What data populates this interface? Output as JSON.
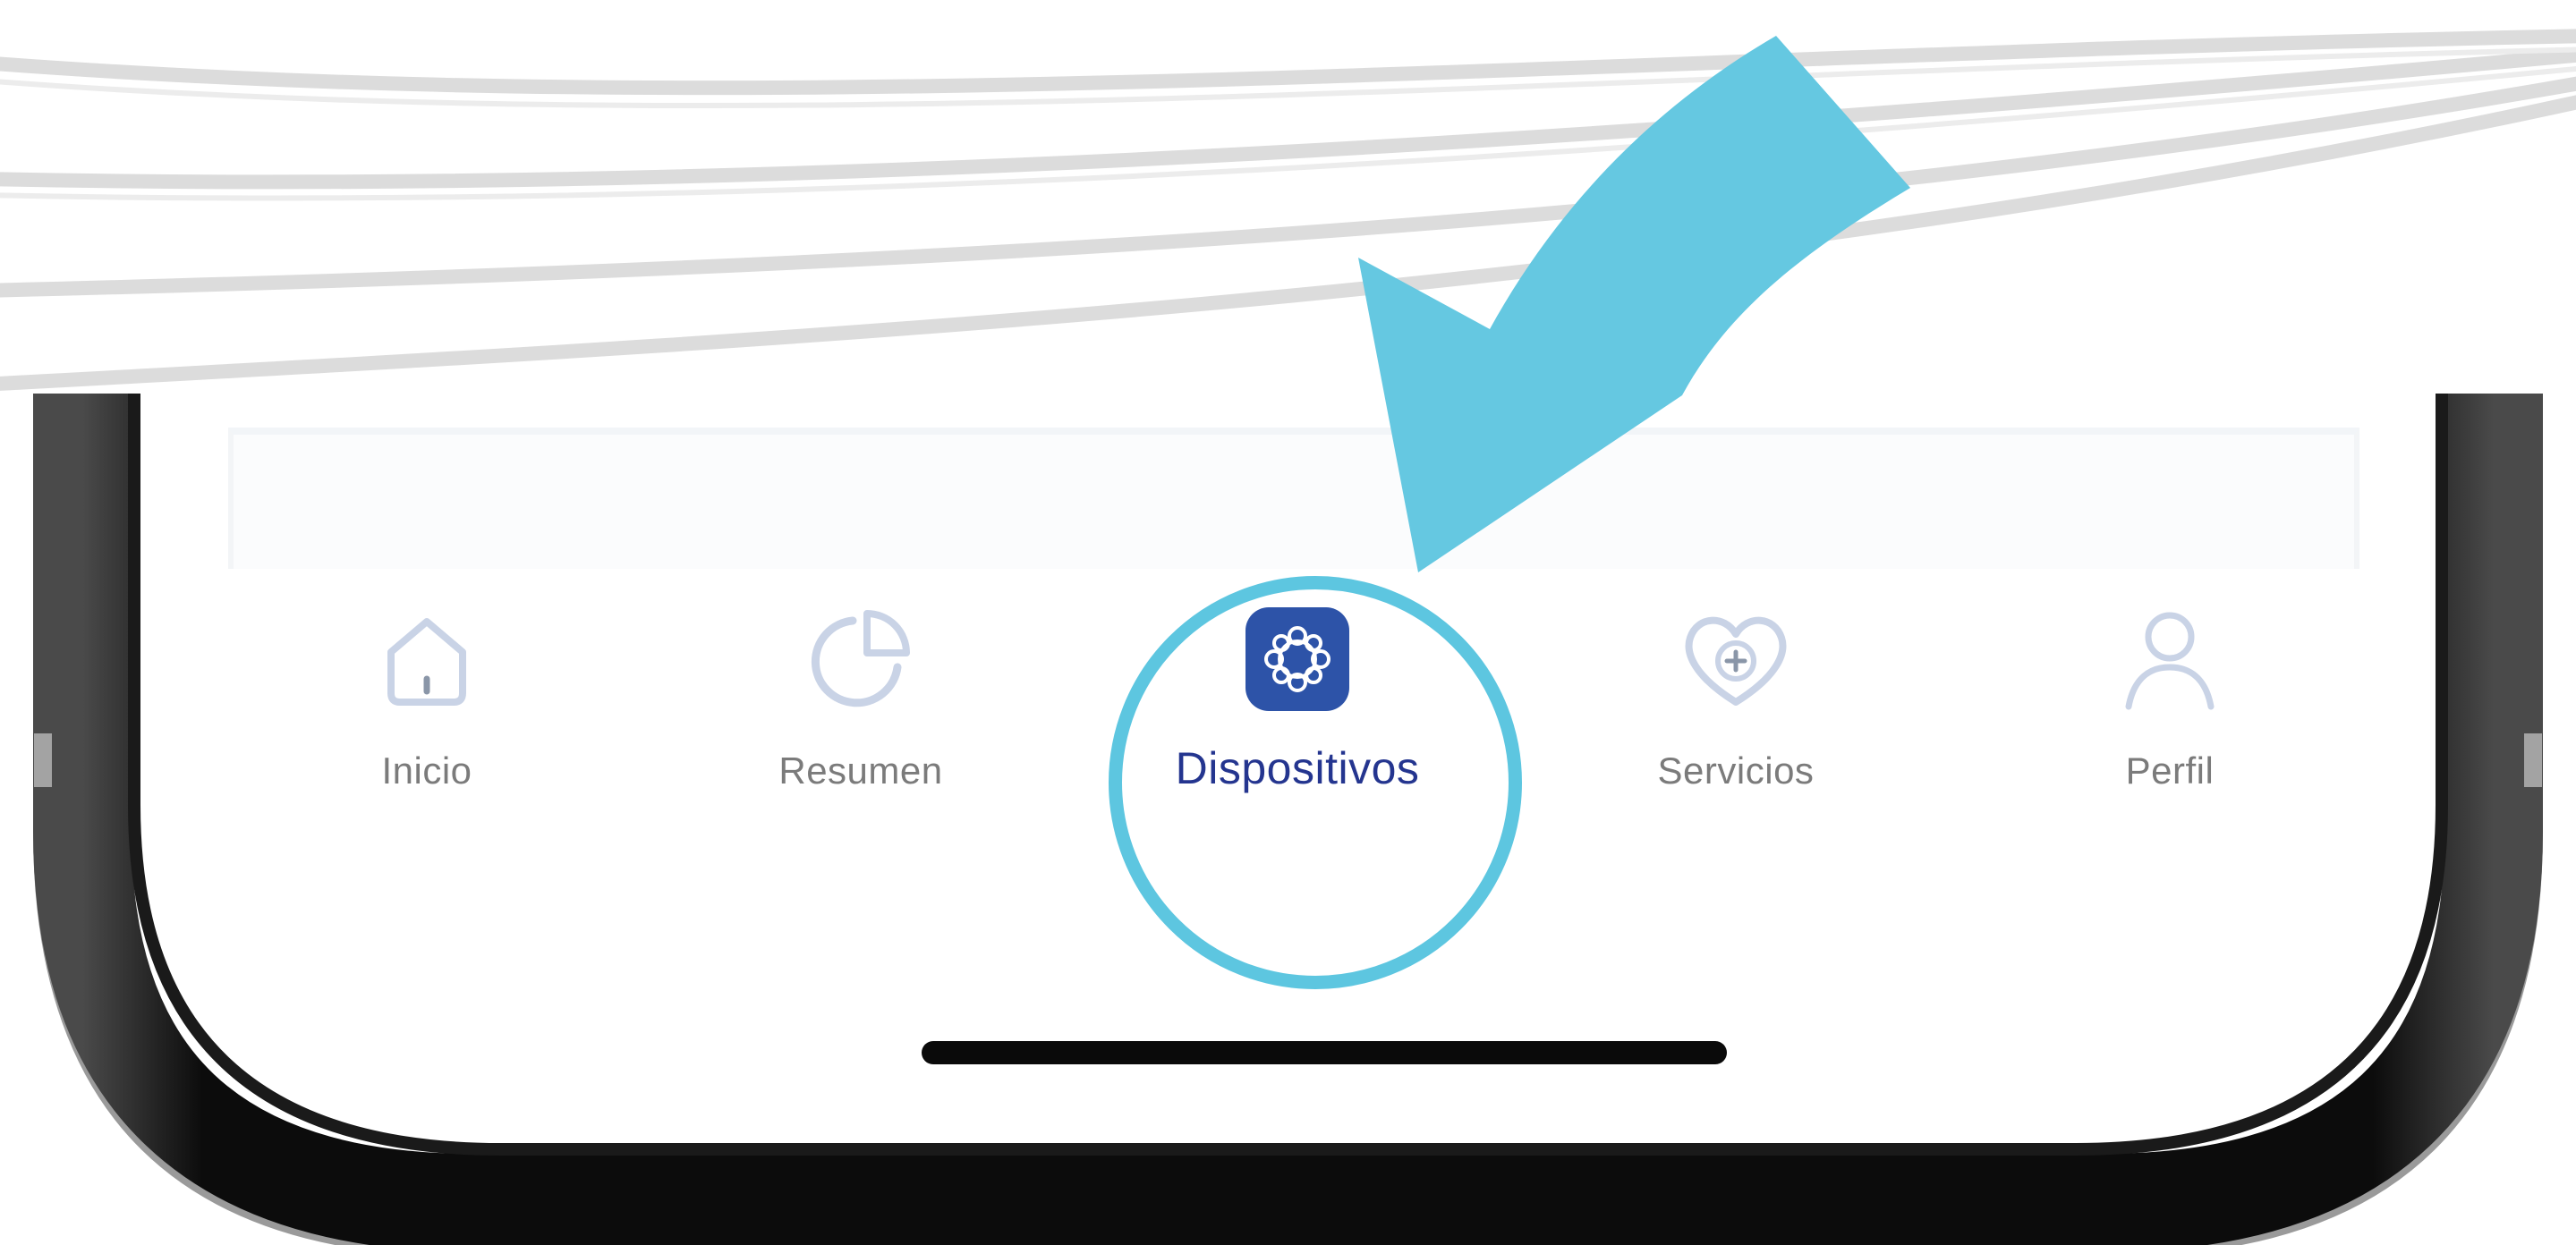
{
  "nav": {
    "tabs": [
      {
        "label": "Inicio",
        "icon": "home-icon",
        "active": false
      },
      {
        "label": "Resumen",
        "icon": "pie-chart-icon",
        "active": false
      },
      {
        "label": "Dispositivos",
        "icon": "devices-icon",
        "active": true
      },
      {
        "label": "Servicios",
        "icon": "heart-plus-icon",
        "active": false
      },
      {
        "label": "Perfil",
        "icon": "user-icon",
        "active": false
      }
    ]
  },
  "colors": {
    "accent": "#24358f",
    "highlight": "#5dc6e0",
    "inactive_label": "#7b7b7b",
    "inactive_icon": "#c9d3e6"
  }
}
